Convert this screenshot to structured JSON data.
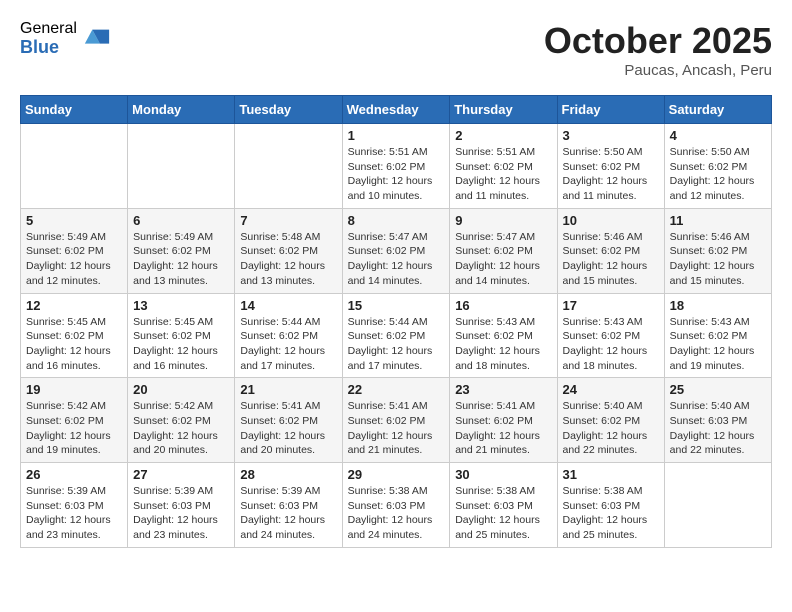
{
  "logo": {
    "general": "General",
    "blue": "Blue"
  },
  "title": "October 2025",
  "location": "Paucas, Ancash, Peru",
  "weekdays": [
    "Sunday",
    "Monday",
    "Tuesday",
    "Wednesday",
    "Thursday",
    "Friday",
    "Saturday"
  ],
  "weeks": [
    [
      {
        "day": "",
        "info": ""
      },
      {
        "day": "",
        "info": ""
      },
      {
        "day": "",
        "info": ""
      },
      {
        "day": "1",
        "info": "Sunrise: 5:51 AM\nSunset: 6:02 PM\nDaylight: 12 hours and 10 minutes."
      },
      {
        "day": "2",
        "info": "Sunrise: 5:51 AM\nSunset: 6:02 PM\nDaylight: 12 hours and 11 minutes."
      },
      {
        "day": "3",
        "info": "Sunrise: 5:50 AM\nSunset: 6:02 PM\nDaylight: 12 hours and 11 minutes."
      },
      {
        "day": "4",
        "info": "Sunrise: 5:50 AM\nSunset: 6:02 PM\nDaylight: 12 hours and 12 minutes."
      }
    ],
    [
      {
        "day": "5",
        "info": "Sunrise: 5:49 AM\nSunset: 6:02 PM\nDaylight: 12 hours and 12 minutes."
      },
      {
        "day": "6",
        "info": "Sunrise: 5:49 AM\nSunset: 6:02 PM\nDaylight: 12 hours and 13 minutes."
      },
      {
        "day": "7",
        "info": "Sunrise: 5:48 AM\nSunset: 6:02 PM\nDaylight: 12 hours and 13 minutes."
      },
      {
        "day": "8",
        "info": "Sunrise: 5:47 AM\nSunset: 6:02 PM\nDaylight: 12 hours and 14 minutes."
      },
      {
        "day": "9",
        "info": "Sunrise: 5:47 AM\nSunset: 6:02 PM\nDaylight: 12 hours and 14 minutes."
      },
      {
        "day": "10",
        "info": "Sunrise: 5:46 AM\nSunset: 6:02 PM\nDaylight: 12 hours and 15 minutes."
      },
      {
        "day": "11",
        "info": "Sunrise: 5:46 AM\nSunset: 6:02 PM\nDaylight: 12 hours and 15 minutes."
      }
    ],
    [
      {
        "day": "12",
        "info": "Sunrise: 5:45 AM\nSunset: 6:02 PM\nDaylight: 12 hours and 16 minutes."
      },
      {
        "day": "13",
        "info": "Sunrise: 5:45 AM\nSunset: 6:02 PM\nDaylight: 12 hours and 16 minutes."
      },
      {
        "day": "14",
        "info": "Sunrise: 5:44 AM\nSunset: 6:02 PM\nDaylight: 12 hours and 17 minutes."
      },
      {
        "day": "15",
        "info": "Sunrise: 5:44 AM\nSunset: 6:02 PM\nDaylight: 12 hours and 17 minutes."
      },
      {
        "day": "16",
        "info": "Sunrise: 5:43 AM\nSunset: 6:02 PM\nDaylight: 12 hours and 18 minutes."
      },
      {
        "day": "17",
        "info": "Sunrise: 5:43 AM\nSunset: 6:02 PM\nDaylight: 12 hours and 18 minutes."
      },
      {
        "day": "18",
        "info": "Sunrise: 5:43 AM\nSunset: 6:02 PM\nDaylight: 12 hours and 19 minutes."
      }
    ],
    [
      {
        "day": "19",
        "info": "Sunrise: 5:42 AM\nSunset: 6:02 PM\nDaylight: 12 hours and 19 minutes."
      },
      {
        "day": "20",
        "info": "Sunrise: 5:42 AM\nSunset: 6:02 PM\nDaylight: 12 hours and 20 minutes."
      },
      {
        "day": "21",
        "info": "Sunrise: 5:41 AM\nSunset: 6:02 PM\nDaylight: 12 hours and 20 minutes."
      },
      {
        "day": "22",
        "info": "Sunrise: 5:41 AM\nSunset: 6:02 PM\nDaylight: 12 hours and 21 minutes."
      },
      {
        "day": "23",
        "info": "Sunrise: 5:41 AM\nSunset: 6:02 PM\nDaylight: 12 hours and 21 minutes."
      },
      {
        "day": "24",
        "info": "Sunrise: 5:40 AM\nSunset: 6:02 PM\nDaylight: 12 hours and 22 minutes."
      },
      {
        "day": "25",
        "info": "Sunrise: 5:40 AM\nSunset: 6:03 PM\nDaylight: 12 hours and 22 minutes."
      }
    ],
    [
      {
        "day": "26",
        "info": "Sunrise: 5:39 AM\nSunset: 6:03 PM\nDaylight: 12 hours and 23 minutes."
      },
      {
        "day": "27",
        "info": "Sunrise: 5:39 AM\nSunset: 6:03 PM\nDaylight: 12 hours and 23 minutes."
      },
      {
        "day": "28",
        "info": "Sunrise: 5:39 AM\nSunset: 6:03 PM\nDaylight: 12 hours and 24 minutes."
      },
      {
        "day": "29",
        "info": "Sunrise: 5:38 AM\nSunset: 6:03 PM\nDaylight: 12 hours and 24 minutes."
      },
      {
        "day": "30",
        "info": "Sunrise: 5:38 AM\nSunset: 6:03 PM\nDaylight: 12 hours and 25 minutes."
      },
      {
        "day": "31",
        "info": "Sunrise: 5:38 AM\nSunset: 6:03 PM\nDaylight: 12 hours and 25 minutes."
      },
      {
        "day": "",
        "info": ""
      }
    ]
  ]
}
